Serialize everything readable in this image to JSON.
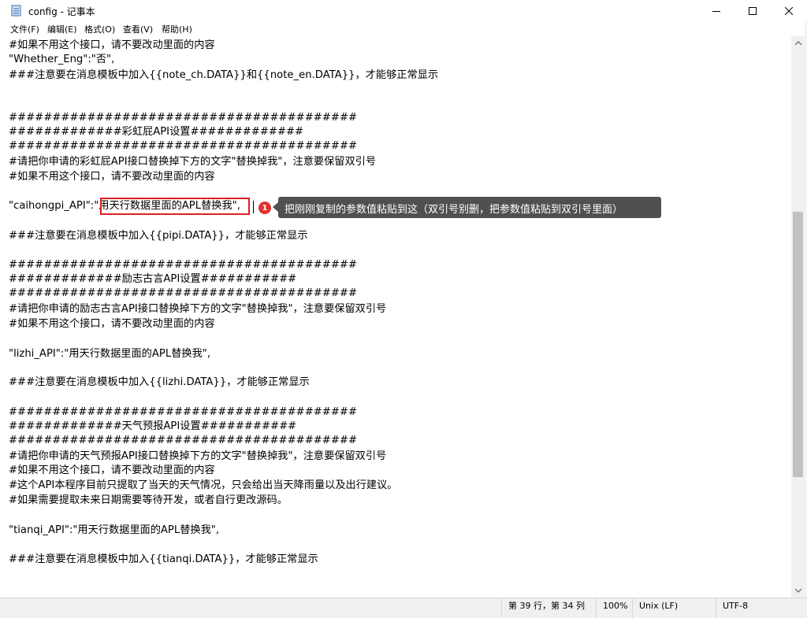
{
  "window": {
    "title": "config - 记事本",
    "controls": {
      "minimize": "minimize-icon",
      "maximize": "maximize-icon",
      "close": "close-icon"
    }
  },
  "menu": [
    "文件(F)",
    "编辑(E)",
    "格式(O)",
    "查看(V)",
    "帮助(H)"
  ],
  "editor": {
    "lines": [
      "#如果不用这个接口，请不要改动里面的内容",
      "\"Whether_Eng\":\"否\",",
      "###注意要在消息模板中加入{{note_ch.DATA}}和{{note_en.DATA}}，才能够正常显示",
      "",
      "",
      "########################################",
      "#############彩虹屁API设置#############",
      "########################################",
      "#请把你申请的彩虹屁API接口替换掉下方的文字\"替换掉我\"，注意要保留双引号",
      "#如果不用这个接口，请不要改动里面的内容",
      "",
      "\"caihongpi_API\":\"用天行数据里面的APL替换我\",",
      "",
      "###注意要在消息模板中加入{{pipi.DATA}}，才能够正常显示",
      "",
      "########################################",
      "#############励志古言API设置###########",
      "########################################",
      "#请把你申请的励志古言API接口替换掉下方的文字\"替换掉我\"，注意要保留双引号",
      "#如果不用这个接口，请不要改动里面的内容",
      "",
      "\"lizhi_API\":\"用天行数据里面的APL替换我\",",
      "",
      "###注意要在消息模板中加入{{lizhi.DATA}}，才能够正常显示",
      "",
      "########################################",
      "#############天气预报API设置###########",
      "########################################",
      "#请把你申请的天气预报API接口替换掉下方的文字\"替换掉我\"，注意要保留双引号",
      "#如果不用这个接口，请不要改动里面的内容",
      "#这个API本程序目前只提取了当天的天气情况，只会给出当天降雨量以及出行建议。",
      "#如果需要提取未来日期需要等待开发，或者自行更改源码。",
      "",
      "\"tianqi_API\":\"用天行数据里面的APL替换我\",",
      "",
      "###注意要在消息模板中加入{{tianqi.DATA}}，才能够正常显示"
    ]
  },
  "annotation": {
    "badge_number": "1",
    "tooltip": "把刚刚复制的参数值粘贴到这（双引号别删，把参数值粘贴到双引号里面）",
    "highlight_color": "#e02020"
  },
  "status": {
    "position": "第 39 行，第 34 列",
    "zoom": "100%",
    "line_ending": "Unix (LF)",
    "encoding": "UTF-8"
  }
}
